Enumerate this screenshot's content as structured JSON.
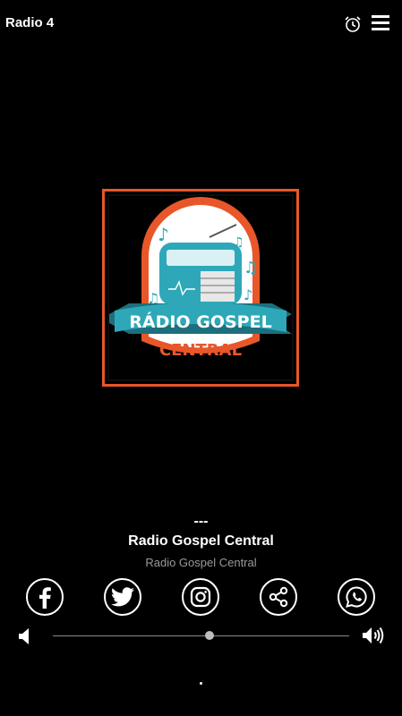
{
  "app": {
    "title": "Radio 4"
  },
  "icons": {
    "alarm": "alarm-icon",
    "menu": "menu-icon",
    "facebook": "facebook-icon",
    "twitter": "twitter-icon",
    "instagram": "instagram-icon",
    "share": "share-icon",
    "whatsapp": "whatsapp-icon",
    "volume_low": "volume-low-icon",
    "volume_high": "volume-high-icon"
  },
  "logo": {
    "line1": "RÁDIO GOSPEL",
    "line2": "CENTRAL",
    "colors": {
      "frame": "#e8572a",
      "teal": "#2ea8b8",
      "dark_teal": "#1d6f7d"
    }
  },
  "player": {
    "track": "---",
    "station": "Radio Gospel Central",
    "subtitle": "Radio Gospel Central"
  },
  "volume": {
    "level": 0.53
  }
}
